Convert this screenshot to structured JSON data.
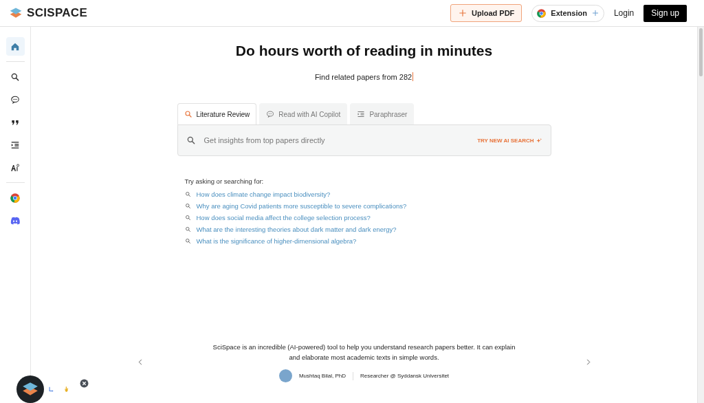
{
  "header": {
    "brand": "SCISPACE",
    "upload": "Upload PDF",
    "extension": "Extension",
    "login": "Login",
    "signup": "Sign up"
  },
  "sidebar": {
    "items": [
      {
        "kind": "home",
        "selected": true
      },
      {
        "kind": "search",
        "selected": false
      },
      {
        "kind": "chat",
        "selected": false
      },
      {
        "kind": "quote",
        "selected": false
      },
      {
        "kind": "indent",
        "selected": false
      },
      {
        "kind": "ai",
        "selected": false
      }
    ],
    "links": [
      {
        "kind": "chrome"
      },
      {
        "kind": "discord"
      }
    ]
  },
  "hero": {
    "title": "Do hours worth of reading in minutes",
    "subtitle": "Find related papers from 282"
  },
  "tabs": [
    {
      "label": "Literature Review",
      "kind": "search",
      "selected": true
    },
    {
      "label": "Read with AI Copilot",
      "kind": "chat",
      "selected": false
    },
    {
      "label": "Paraphraser",
      "kind": "indent",
      "selected": false
    }
  ],
  "search": {
    "placeholder": "Get insights from top papers directly",
    "ai_link": "TRY NEW AI SEARCH"
  },
  "suggestions": {
    "heading": "Try asking or searching for:",
    "items": [
      "How does climate change impact biodiversity?",
      "Why are aging Covid patients more susceptible to severe complications?",
      "How does social media affect the college selection process?",
      "What are the interesting theories about dark matter and dark energy?",
      "What is the significance of higher-dimensional algebra?"
    ]
  },
  "testimonial": {
    "quote": "SciSpace is an incredible (AI-powered) tool to help you understand research papers better. It can explain and elaborate most academic texts in simple words.",
    "author": "Mushtaq Bilal, PhD",
    "role": "Researcher @ Syddansk Universitet"
  }
}
